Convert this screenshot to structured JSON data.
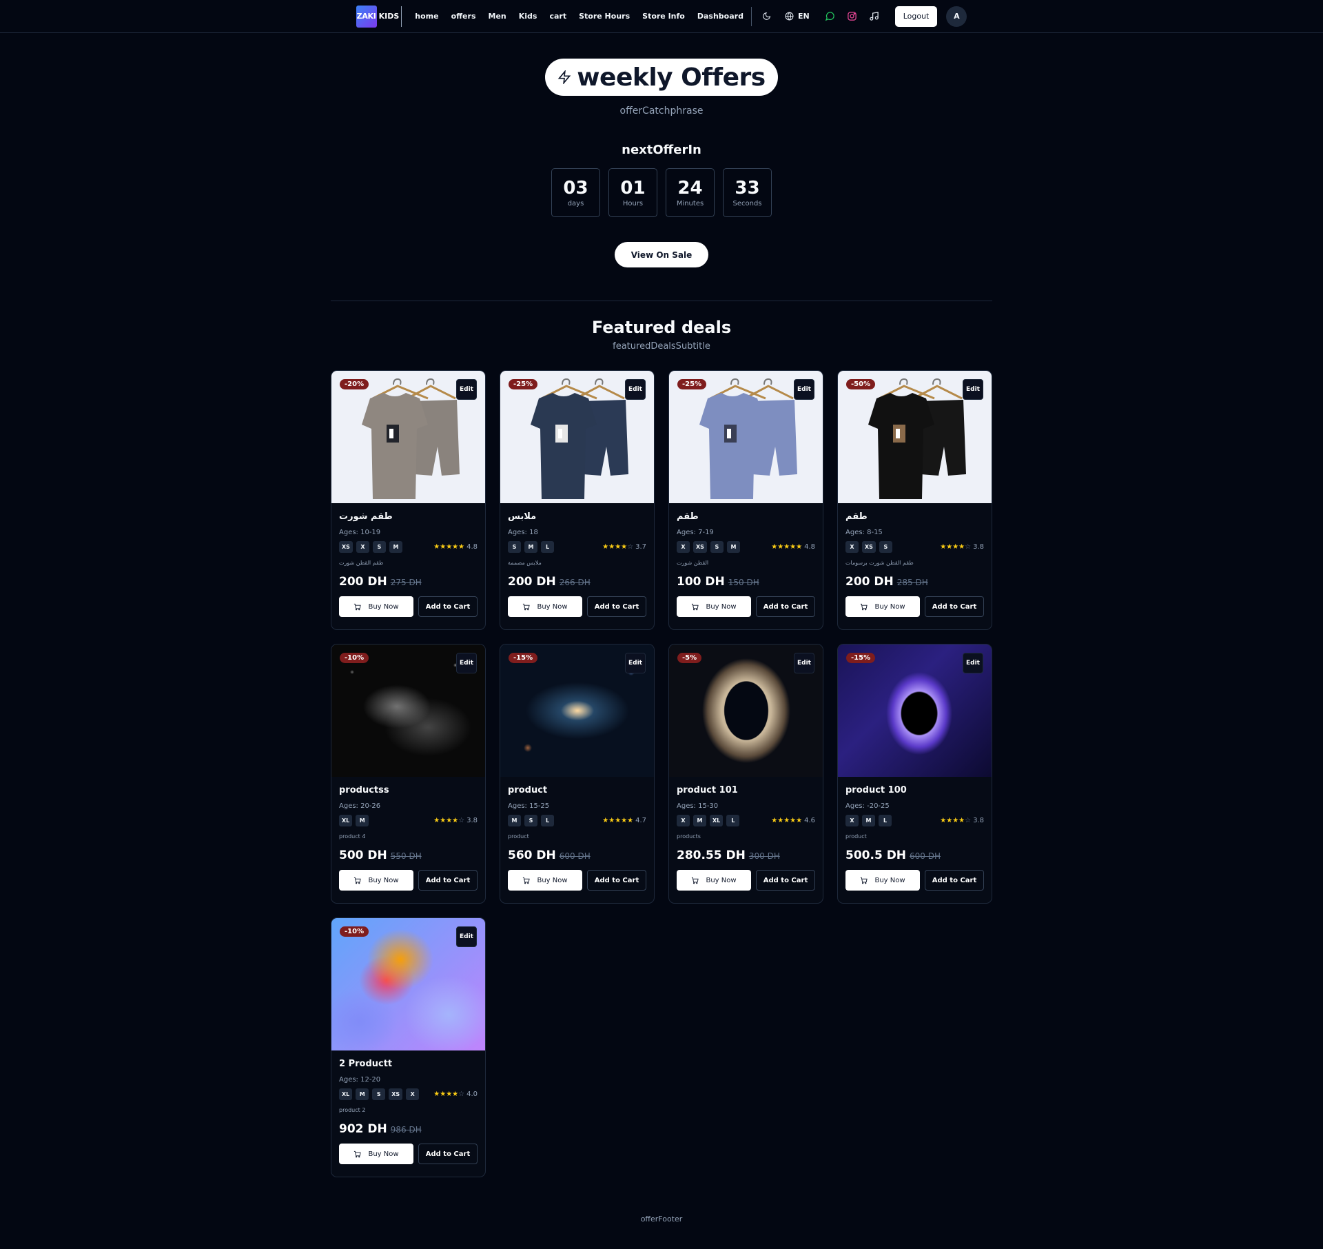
{
  "nav": {
    "logo_a": "ZAKI",
    "logo_b": "KIDS",
    "links": [
      "home",
      "offers",
      "Men",
      "Kids",
      "cart",
      "Store Hours",
      "Store Info",
      "Dashboard"
    ],
    "lang": "EN",
    "logout": "Logout",
    "avatar": "A"
  },
  "hero": {
    "title": "weekly Offers",
    "catchphrase": "offerCatchphrase",
    "next_title": "nextOfferIn",
    "countdown": [
      {
        "value": "03",
        "label": "days"
      },
      {
        "value": "01",
        "label": "Hours"
      },
      {
        "value": "24",
        "label": "Minutes"
      },
      {
        "value": "33",
        "label": "Seconds"
      }
    ],
    "view_button": "View On Sale"
  },
  "featured": {
    "title": "Featured deals",
    "subtitle": "featuredDealsSubtitle"
  },
  "labels": {
    "edit": "Edit",
    "buy_now": "Buy Now",
    "add_to_cart": "Add to Cart"
  },
  "products": [
    {
      "badge": "-20%",
      "name": "طقم شورت",
      "ages": "Ages: 10-19",
      "sizes": [
        "XS",
        "X",
        "S",
        "M"
      ],
      "rating": "4.8",
      "stars": 5,
      "desc": "طقم القطن شورت",
      "price": "200 DH",
      "old_price": "275 DH",
      "image": "tshirt-grey"
    },
    {
      "badge": "-25%",
      "name": "ملابس",
      "ages": "Ages: 18",
      "sizes": [
        "S",
        "M",
        "L"
      ],
      "rating": "3.7",
      "stars": 4,
      "desc": "ملابس مصممة",
      "price": "200 DH",
      "old_price": "266 DH",
      "image": "tshirt-navy"
    },
    {
      "badge": "-25%",
      "name": "طقم",
      "ages": "Ages: 7-19",
      "sizes": [
        "X",
        "XS",
        "S",
        "M"
      ],
      "rating": "4.8",
      "stars": 5,
      "desc": "القطن شورت",
      "price": "100 DH",
      "old_price": "150 DH",
      "image": "tshirt-blue"
    },
    {
      "badge": "-50%",
      "name": "طقم",
      "ages": "Ages: 8-15",
      "sizes": [
        "X",
        "XS",
        "S"
      ],
      "rating": "3.8",
      "stars": 4,
      "desc": "طقم القطن شورت برسومات",
      "price": "200 DH",
      "old_price": "285 DH",
      "image": "tshirt-black"
    },
    {
      "badge": "-10%",
      "name": "productss",
      "ages": "Ages: 20-26",
      "sizes": [
        "XL",
        "M"
      ],
      "rating": "3.8",
      "stars": 4,
      "desc": "product 4",
      "price": "500 DH",
      "old_price": "550 DH",
      "image": "nebula-grey"
    },
    {
      "badge": "-15%",
      "name": "product",
      "ages": "Ages: 15-25",
      "sizes": [
        "M",
        "S",
        "L"
      ],
      "rating": "4.7",
      "stars": 5,
      "desc": "product",
      "price": "560 DH",
      "old_price": "600 DH",
      "image": "galaxy-spiral"
    },
    {
      "badge": "-5%",
      "name": "product 101",
      "ages": "Ages: 15-30",
      "sizes": [
        "X",
        "M",
        "XL",
        "L"
      ],
      "rating": "4.6",
      "stars": 5,
      "desc": "products",
      "price": "280.55 DH",
      "old_price": "300 DH",
      "image": "wormhole-gold"
    },
    {
      "badge": "-15%",
      "name": "product 100",
      "ages": "Ages: -20-25",
      "sizes": [
        "X",
        "M",
        "L"
      ],
      "rating": "3.8",
      "stars": 4,
      "desc": "product",
      "price": "500.5 DH",
      "old_price": "600 DH",
      "image": "blackhole-purple"
    },
    {
      "badge": "-10%",
      "name": "2 Productt",
      "ages": "Ages: 12-20",
      "sizes": [
        "XL",
        "M",
        "S",
        "XS",
        "X"
      ],
      "rating": "4.0",
      "stars": 4,
      "desc": "product 2",
      "price": "902 DH",
      "old_price": "986 DH",
      "image": "abstract-gradient"
    }
  ],
  "footer": "offerFooter",
  "colors": {
    "background": "#030712",
    "badge": "#7f1d1d",
    "star": "#facc15",
    "logo_gradient": [
      "#3b82f6",
      "#7c3aed"
    ]
  }
}
